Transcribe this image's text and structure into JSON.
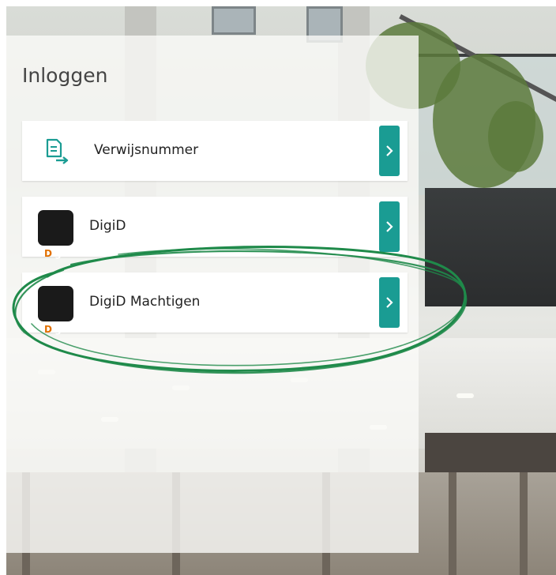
{
  "panel": {
    "title": "Inloggen"
  },
  "login_options": [
    {
      "label": "Verwijsnummer",
      "icon": "document-arrow-icon"
    },
    {
      "label": "DigiD",
      "icon": "digid-logo",
      "logo_text_main": "Digi",
      "logo_text_accent": "D"
    },
    {
      "label": "DigiD Machtigen",
      "icon": "digid-logo",
      "logo_text_main": "Digi",
      "logo_text_accent": "D"
    }
  ],
  "colors": {
    "accent_teal": "#1a9c93",
    "highlight_green": "#1f8a4a",
    "digid_orange": "#e17000",
    "digid_black": "#1a1a1a"
  }
}
